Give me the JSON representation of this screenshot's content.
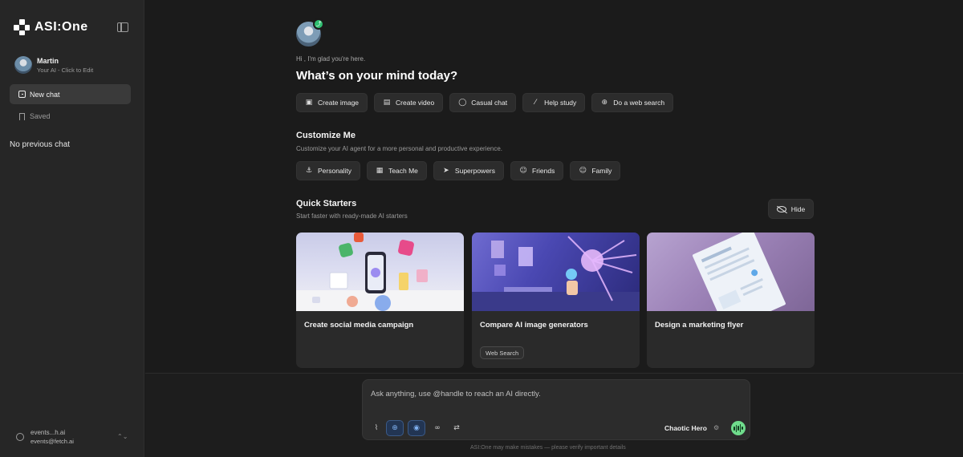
{
  "app": {
    "logo_text": "ASI:One"
  },
  "sidebar": {
    "profile": {
      "name": "Martin",
      "subtitle": "Your AI - Click to Edit"
    },
    "new_chat_label": "New chat",
    "saved_label": "Saved",
    "empty_history": "No previous chat",
    "account": {
      "name": "events...h.ai",
      "email": "events@fetch.ai"
    }
  },
  "main": {
    "greeting": "Hi , I'm glad you're here.",
    "headline": "What’s on your mind today?",
    "quick_actions": [
      {
        "label": "Create image",
        "icon": "image-icon"
      },
      {
        "label": "Create video",
        "icon": "film-icon"
      },
      {
        "label": "Casual chat",
        "icon": "chat-bubble-icon"
      },
      {
        "label": "Help study",
        "icon": "magic-wand-icon"
      },
      {
        "label": "Do a web search",
        "icon": "globe-icon"
      }
    ],
    "customize": {
      "title": "Customize Me",
      "subtitle": "Customize your AI agent for a more personal and productive experience.",
      "options": [
        {
          "label": "Personality",
          "icon": "anchor-icon"
        },
        {
          "label": "Teach Me",
          "icon": "printer-icon"
        },
        {
          "label": "Superpowers",
          "icon": "send-icon"
        },
        {
          "label": "Friends",
          "icon": "users-icon"
        },
        {
          "label": "Family",
          "icon": "users-icon"
        }
      ]
    },
    "quick_starters": {
      "title": "Quick Starters",
      "subtitle": "Start faster with ready-made AI starters",
      "hide_label": "Hide",
      "cards": [
        {
          "title": "Create social media campaign",
          "tag": ""
        },
        {
          "title": "Compare AI image generators",
          "tag": "Web Search"
        },
        {
          "title": "Design a marketing flyer",
          "tag": ""
        }
      ]
    }
  },
  "composer": {
    "placeholder": "Ask anything, use @handle to reach an AI directly.",
    "model_name": "Chaotic Hero",
    "disclaimer": "ASI:One may make mistakes — please verify important details",
    "accent_color": "#6fdc8c"
  }
}
